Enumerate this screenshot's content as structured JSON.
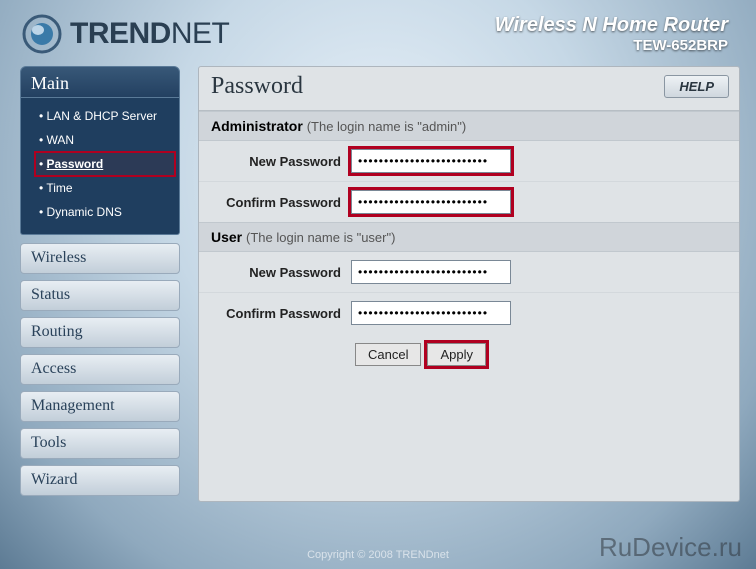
{
  "header": {
    "brand_text": "TRENDNET",
    "product_title": "Wireless N Home Router",
    "product_model": "TEW-652BRP"
  },
  "sidebar": {
    "main_label": "Main",
    "main_items": [
      {
        "label": "LAN & DHCP Server",
        "active": false
      },
      {
        "label": "WAN",
        "active": false
      },
      {
        "label": "Password",
        "active": true
      },
      {
        "label": "Time",
        "active": false
      },
      {
        "label": "Dynamic DNS",
        "active": false
      }
    ],
    "sections": [
      {
        "label": "Wireless"
      },
      {
        "label": "Status"
      },
      {
        "label": "Routing"
      },
      {
        "label": "Access"
      },
      {
        "label": "Management"
      },
      {
        "label": "Tools"
      },
      {
        "label": "Wizard"
      }
    ]
  },
  "content": {
    "title": "Password",
    "help_label": "HELP",
    "admin_section": {
      "heading": "Administrator",
      "hint": "(The login name is \"admin\")",
      "new_pw_label": "New Password",
      "confirm_pw_label": "Confirm Password",
      "new_pw_value": "•••••••••••••••••••••••••",
      "confirm_pw_value": "•••••••••••••••••••••••••"
    },
    "user_section": {
      "heading": "User",
      "hint": "(The login name is \"user\")",
      "new_pw_label": "New Password",
      "confirm_pw_label": "Confirm Password",
      "new_pw_value": "•••••••••••••••••••••••••",
      "confirm_pw_value": "•••••••••••••••••••••••••"
    },
    "buttons": {
      "cancel": "Cancel",
      "apply": "Apply"
    }
  },
  "footer": "Copyright © 2008 TRENDnet",
  "watermark": "RuDevice.ru"
}
